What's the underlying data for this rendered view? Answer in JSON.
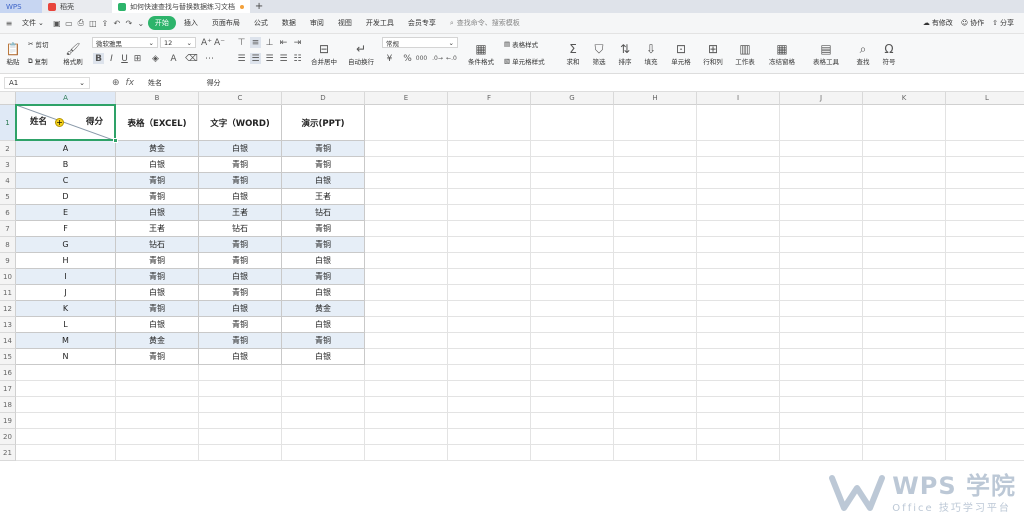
{
  "tabs": [
    {
      "label": "WPS"
    },
    {
      "label": "稻壳"
    },
    {
      "label": "如何快速查找与替换数据练习文档"
    }
  ],
  "menubar": {
    "file": "文件",
    "items": [
      "开始",
      "插入",
      "页面布局",
      "公式",
      "数据",
      "审阅",
      "视图",
      "开发工具",
      "会员专享"
    ],
    "search_placeholder": "查找命令、搜索模板",
    "right": [
      "有修改",
      "协作",
      "分享"
    ]
  },
  "ribbon": {
    "paste": "粘贴",
    "cut": "剪切",
    "copy": "复制",
    "format_painter": "格式刷",
    "font_name": "微软雅黑",
    "font_size": "12",
    "merge_center": "合并居中",
    "wrap_text": "自动换行",
    "number_format": "常规",
    "cond_format": "条件格式",
    "table_style": "表格样式",
    "cell_style": "单元格样式",
    "sum": "求和",
    "filter": "筛选",
    "sort": "排序",
    "fill": "填充",
    "cell": "单元格",
    "row_col": "行和列",
    "worksheet": "工作表",
    "freeze": "冻结窗格",
    "table_tools": "表格工具",
    "find": "查找",
    "symbol": "符号"
  },
  "formula_bar": {
    "cell_ref": "A1",
    "content_left": "姓名",
    "content_right": "得分"
  },
  "sheet": {
    "columns": [
      "A",
      "B",
      "C",
      "D",
      "E",
      "F",
      "G",
      "H",
      "I",
      "J",
      "K",
      "L"
    ],
    "rows": [
      "1",
      "2",
      "3",
      "4",
      "5",
      "6",
      "7",
      "8",
      "9",
      "10",
      "11",
      "12",
      "13",
      "14",
      "15",
      "16",
      "17",
      "18",
      "19",
      "20",
      "21"
    ],
    "header": {
      "a1_left": "姓名",
      "a1_right": "得分",
      "b1": "表格（EXCEL)",
      "c1": "文字（WORD)",
      "d1": "演示(PPT)"
    },
    "data": [
      [
        "A",
        "黄金",
        "白银",
        "青铜"
      ],
      [
        "B",
        "白银",
        "青铜",
        "青铜"
      ],
      [
        "C",
        "青铜",
        "青铜",
        "白银"
      ],
      [
        "D",
        "青铜",
        "白银",
        "王者"
      ],
      [
        "E",
        "白银",
        "王者",
        "钻石"
      ],
      [
        "F",
        "王者",
        "钻石",
        "青铜"
      ],
      [
        "G",
        "钻石",
        "青铜",
        "青铜"
      ],
      [
        "H",
        "青铜",
        "青铜",
        "白银"
      ],
      [
        "I",
        "青铜",
        "白银",
        "青铜"
      ],
      [
        "J",
        "白银",
        "青铜",
        "白银"
      ],
      [
        "K",
        "青铜",
        "白银",
        "黄金"
      ],
      [
        "L",
        "白银",
        "青铜",
        "白银"
      ],
      [
        "M",
        "黄金",
        "青铜",
        "青铜"
      ],
      [
        "N",
        "青铜",
        "白银",
        "白银"
      ]
    ]
  },
  "watermark": {
    "title": "WPS 学院",
    "subtitle": "Office 技巧学习平台"
  },
  "colors": {
    "accent_green": "#2db46b",
    "selection": "#2ea268",
    "stripe": "#e6eef7"
  }
}
